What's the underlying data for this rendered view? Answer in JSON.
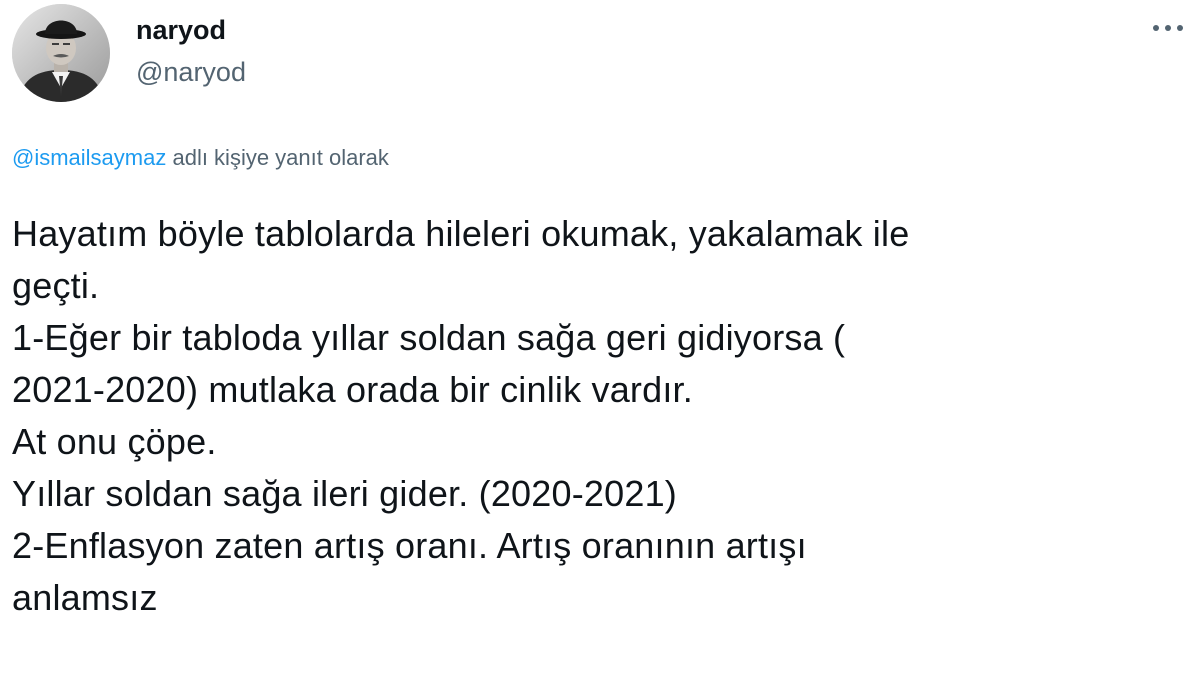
{
  "author": {
    "display_name": "naryod",
    "handle": "@naryod",
    "avatar_icon": "user-avatar-photo"
  },
  "more_icon": "more-horizontal-icon",
  "reply_context": {
    "mention": "@ismailsaymaz",
    "suffix": " adlı kişiye yanıt olarak"
  },
  "tweet_lines": [
    "Hayatım böyle tablolarda hileleri okumak, yakalamak ile",
    "geçti.",
    "1-Eğer bir tabloda yıllar soldan sağa geri gidiyorsa (",
    "2021-2020) mutlaka orada bir cinlik vardır.",
    "At onu çöpe.",
    "Yıllar soldan sağa ileri gider. (2020-2021)",
    "2-Enflasyon zaten artış oranı. Artış oranının artışı",
    "anlamsız"
  ],
  "colors": {
    "text_primary": "#0f1419",
    "text_secondary": "#536471",
    "link": "#1d9bf0",
    "background": "#ffffff"
  }
}
